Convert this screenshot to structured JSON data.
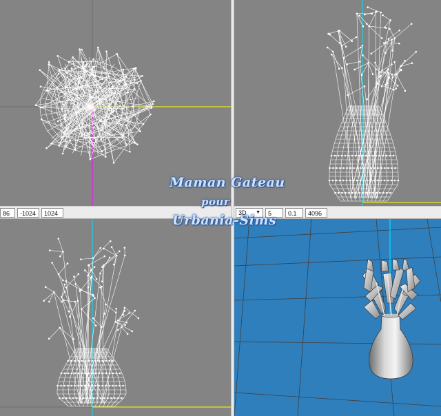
{
  "toolbar_left": {
    "fields": [
      "86",
      "-1024",
      "1024"
    ]
  },
  "toolbar_right": {
    "view_mode": "3D",
    "fields": [
      "5",
      "0.1",
      "4096"
    ]
  },
  "watermark": {
    "line1": "Maman Gateau",
    "line2": "pour",
    "line3": "Urbania-Sims"
  },
  "colors": {
    "viewport_gray": "#848484",
    "viewport_blue": "#2f7fbd",
    "axis_yellow": "#ffff00",
    "axis_magenta": "#ff00ff",
    "axis_cyan": "#00e0ff",
    "wire": "#ffffff"
  },
  "viewports": [
    {
      "id": "top",
      "icon": "wireframe-top-view"
    },
    {
      "id": "front",
      "icon": "wireframe-front-view"
    },
    {
      "id": "side",
      "icon": "wireframe-side-view"
    },
    {
      "id": "perspective",
      "icon": "3d-shaded-view"
    }
  ]
}
